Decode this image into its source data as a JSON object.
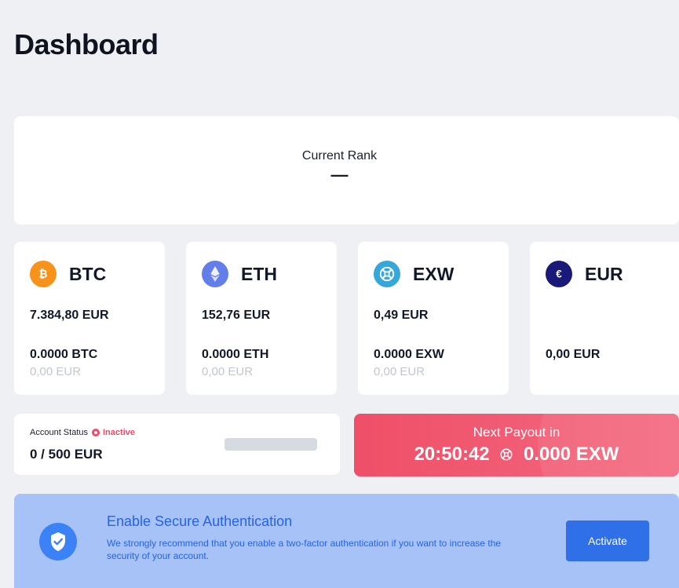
{
  "page": {
    "title": "Dashboard"
  },
  "rank": {
    "label": "Current Rank",
    "value": "—"
  },
  "coins": [
    {
      "symbol": "BTC",
      "icon": "bitcoin-icon",
      "icon_color": "#f7931a",
      "price": "7.384,80 EUR",
      "balance": "0.0000 BTC",
      "fiat_balance": "0,00 EUR"
    },
    {
      "symbol": "ETH",
      "icon": "ethereum-icon",
      "icon_color": "#627eea",
      "price": "152,76 EUR",
      "balance": "0.0000 ETH",
      "fiat_balance": "0,00 EUR"
    },
    {
      "symbol": "EXW",
      "icon": "exw-icon",
      "icon_color": "#35a7d8",
      "price": "0,49 EUR",
      "balance": "0.0000 EXW",
      "fiat_balance": "0,00 EUR"
    },
    {
      "symbol": "EUR",
      "icon": "euro-icon",
      "icon_color": "#19197a",
      "price": "",
      "balance": "0,00 EUR",
      "fiat_balance": ""
    }
  ],
  "account_status": {
    "label": "Account Status",
    "status": "Inactive",
    "amount": "0 / 500 EUR",
    "progress": 0.0,
    "status_color": "#ef4a6a"
  },
  "payout": {
    "label": "Next Payout in",
    "countdown": "20:50:42",
    "amount": "0.000 EXW",
    "color": "#ef4f68"
  },
  "security": {
    "title": "Enable Secure Authentication",
    "description": "We strongly recommend that you enable a two-factor authentication if you want to increase the security of your account.",
    "button_label": "Activate",
    "icon": "shield-check-icon"
  }
}
